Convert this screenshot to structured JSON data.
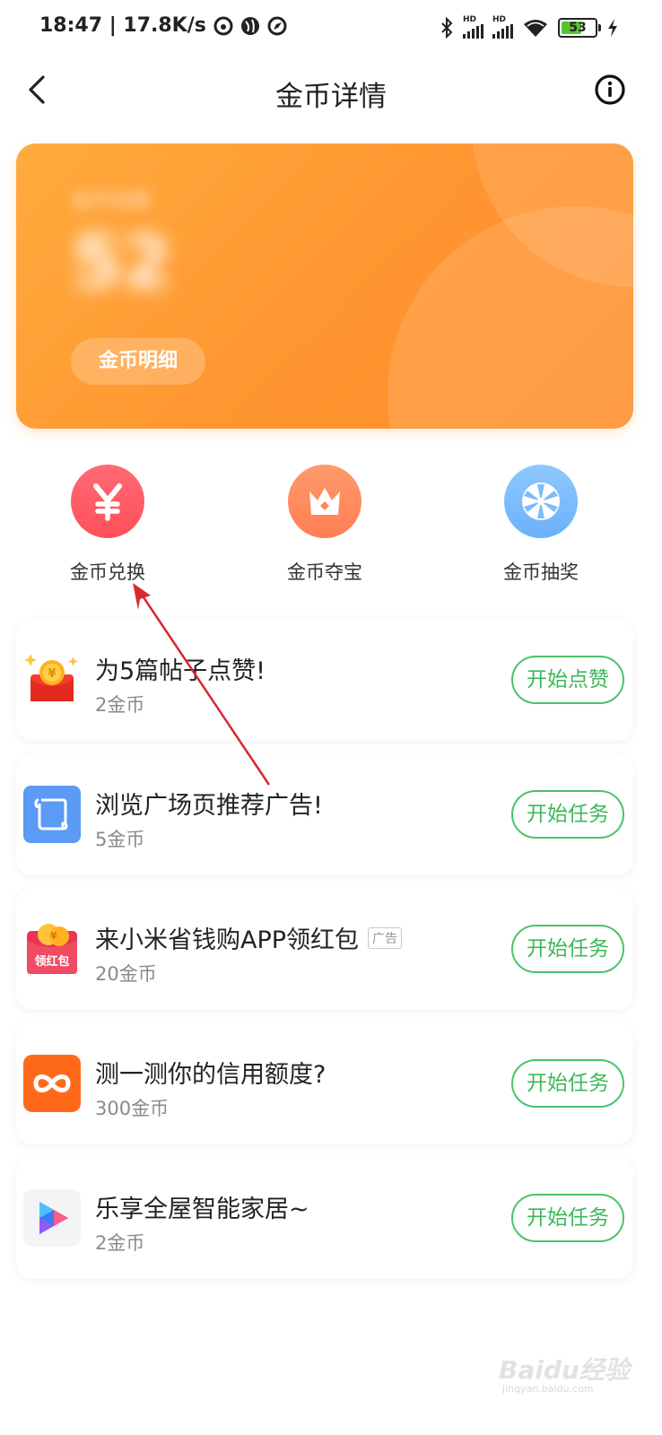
{
  "status_bar": {
    "time_speed": "18:47 | 17.8K/s",
    "battery_level": "53",
    "signal_labels": [
      "HD",
      "HD"
    ]
  },
  "header": {
    "title": "金币详情"
  },
  "coin_card": {
    "balance_label": "金币余额",
    "balance_value": "52",
    "detail_button": "金币明细",
    "colors": {
      "start": "#ffab3e",
      "end": "#ff8e2c"
    }
  },
  "quick_actions": [
    {
      "label": "金币兑换",
      "icon": "yen-icon",
      "color": "#ff5a63"
    },
    {
      "label": "金币夺宝",
      "icon": "crown-icon",
      "color": "#ff875c"
    },
    {
      "label": "金币抽奖",
      "icon": "wheel-icon",
      "color": "#7bbcfc"
    }
  ],
  "tasks": [
    {
      "title": "为5篇帖子点赞!",
      "reward": "2金币",
      "button": "开始点赞",
      "icon": "red-envelope-coin-icon"
    },
    {
      "title": "浏览广场页推荐广告!",
      "reward": "5金币",
      "button": "开始任务",
      "icon": "scroll-icon"
    },
    {
      "title": "来小米省钱购APP领红包",
      "ad_tag": "广告",
      "reward": "20金币",
      "button": "开始任务",
      "icon": "red-packet-icon",
      "icon_text": "领红包"
    },
    {
      "title": "测一测你的信用额度?",
      "reward": "300金币",
      "button": "开始任务",
      "icon": "infinity-icon"
    },
    {
      "title": "乐享全屋智能家居~",
      "reward": "2金币",
      "button": "开始任务",
      "icon": "play-icon"
    }
  ],
  "accent_color": "#4cc36a",
  "watermark": {
    "brand": "Baidu经验",
    "sub": "jingyan.baidu.com"
  }
}
